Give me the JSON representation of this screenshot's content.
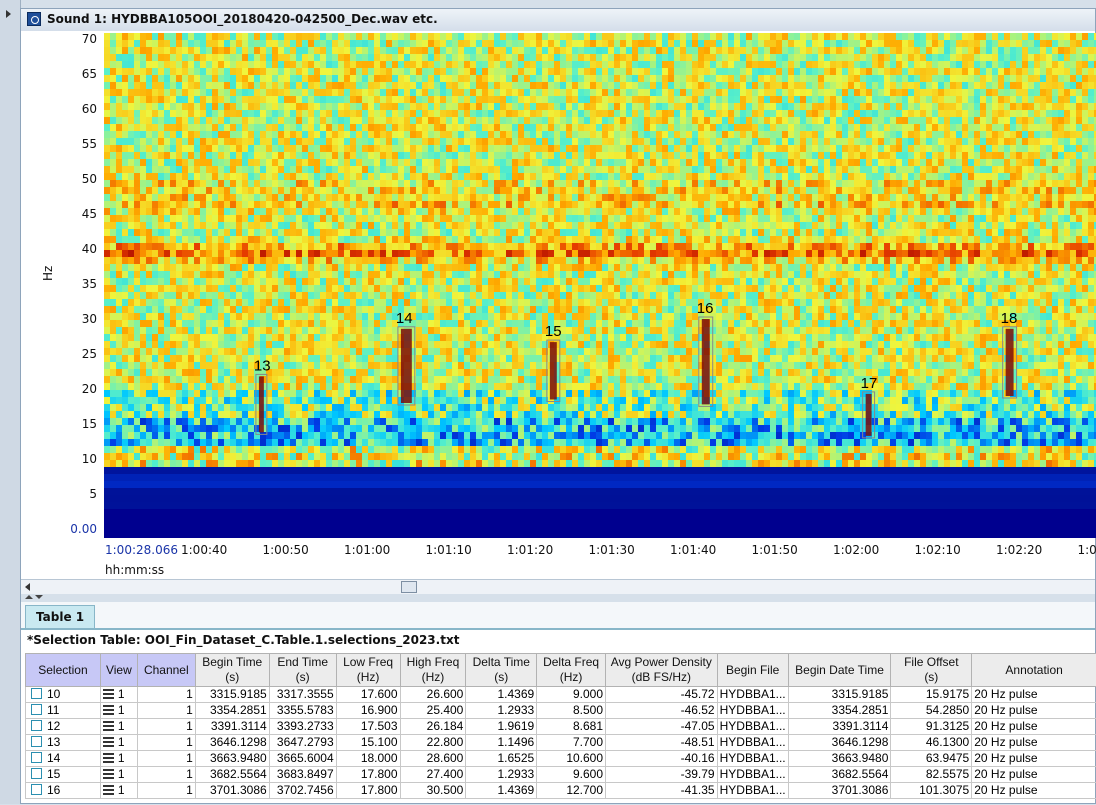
{
  "window": {
    "title": "Sound 1: HYDBBA105OOI_20180420-042500_Dec.wav etc."
  },
  "spectrogram": {
    "y_axis_label": "Hz",
    "y_ticks": [
      "70",
      "65",
      "60",
      "55",
      "50",
      "45",
      "40",
      "35",
      "30",
      "25",
      "20",
      "15",
      "10",
      "5",
      "0.00"
    ],
    "x_ticks": [
      "1:00:28.066",
      "1:00:40",
      "1:00:50",
      "1:01:00",
      "1:01:10",
      "1:01:20",
      "1:01:30",
      "1:01:40",
      "1:01:50",
      "1:02:00",
      "1:02:10",
      "1:02:20",
      "1:0"
    ],
    "x_unit": "hh:mm:ss",
    "selections": [
      {
        "label": "13",
        "t0": 0.155,
        "t1": 0.162,
        "f0": 13.8,
        "f1": 21.8
      },
      {
        "label": "14",
        "t0": 0.298,
        "t1": 0.311,
        "f0": 18.0,
        "f1": 28.6
      },
      {
        "label": "15",
        "t0": 0.448,
        "t1": 0.457,
        "f0": 18.5,
        "f1": 26.7
      },
      {
        "label": "16",
        "t0": 0.601,
        "t1": 0.611,
        "f0": 17.8,
        "f1": 30.0
      },
      {
        "label": "17",
        "t0": 0.766,
        "t1": 0.774,
        "f0": 13.3,
        "f1": 19.3
      },
      {
        "label": "18",
        "t0": 0.907,
        "t1": 0.917,
        "f0": 19.0,
        "f1": 28.6
      }
    ],
    "colors": {
      "low": "#00008f",
      "mid": "#30d0ff",
      "high": "#ffff40",
      "peak": "#b01010"
    }
  },
  "tabs": [
    {
      "label": "Table 1"
    }
  ],
  "table": {
    "title": "*Selection Table: OOI_Fin_Dataset_C.Table.1.selections_2023.txt",
    "columns": [
      {
        "h1": "Selection",
        "h2": ""
      },
      {
        "h1": "View",
        "h2": ""
      },
      {
        "h1": "Channel",
        "h2": ""
      },
      {
        "h1": "Begin Time",
        "h2": "(s)"
      },
      {
        "h1": "End Time",
        "h2": "(s)"
      },
      {
        "h1": "Low Freq",
        "h2": "(Hz)"
      },
      {
        "h1": "High Freq",
        "h2": "(Hz)"
      },
      {
        "h1": "Delta Time",
        "h2": "(s)"
      },
      {
        "h1": "Delta Freq",
        "h2": "(Hz)"
      },
      {
        "h1": "Avg Power Density",
        "h2": "(dB FS/Hz)"
      },
      {
        "h1": "Begin File",
        "h2": ""
      },
      {
        "h1": "Begin Date Time",
        "h2": ""
      },
      {
        "h1": "File Offset",
        "h2": "(s)"
      },
      {
        "h1": "Annotation",
        "h2": ""
      }
    ],
    "rows": [
      [
        "10",
        "1",
        "1",
        "3315.9185",
        "3317.3555",
        "17.600",
        "26.600",
        "1.4369",
        "9.000",
        "-45.72",
        "HYDBBA1...",
        "3315.9185",
        "15.9175",
        "20 Hz pulse"
      ],
      [
        "11",
        "1",
        "1",
        "3354.2851",
        "3355.5783",
        "16.900",
        "25.400",
        "1.2933",
        "8.500",
        "-46.52",
        "HYDBBA1...",
        "3354.2851",
        "54.2850",
        "20 Hz pulse"
      ],
      [
        "12",
        "1",
        "1",
        "3391.3114",
        "3393.2733",
        "17.503",
        "26.184",
        "1.9619",
        "8.681",
        "-47.05",
        "HYDBBA1...",
        "3391.3114",
        "91.3125",
        "20 Hz pulse"
      ],
      [
        "13",
        "1",
        "1",
        "3646.1298",
        "3647.2793",
        "15.100",
        "22.800",
        "1.1496",
        "7.700",
        "-48.51",
        "HYDBBA1...",
        "3646.1298",
        "46.1300",
        "20 Hz pulse"
      ],
      [
        "14",
        "1",
        "1",
        "3663.9480",
        "3665.6004",
        "18.000",
        "28.600",
        "1.6525",
        "10.600",
        "-40.16",
        "HYDBBA1...",
        "3663.9480",
        "63.9475",
        "20 Hz pulse"
      ],
      [
        "15",
        "1",
        "1",
        "3682.5564",
        "3683.8497",
        "17.800",
        "27.400",
        "1.2933",
        "9.600",
        "-39.79",
        "HYDBBA1...",
        "3682.5564",
        "82.5575",
        "20 Hz pulse"
      ],
      [
        "16",
        "1",
        "1",
        "3701.3086",
        "3702.7456",
        "17.800",
        "30.500",
        "1.4369",
        "12.700",
        "-41.35",
        "HYDBBA1...",
        "3701.3086",
        "101.3075",
        "20 Hz pulse"
      ]
    ]
  }
}
